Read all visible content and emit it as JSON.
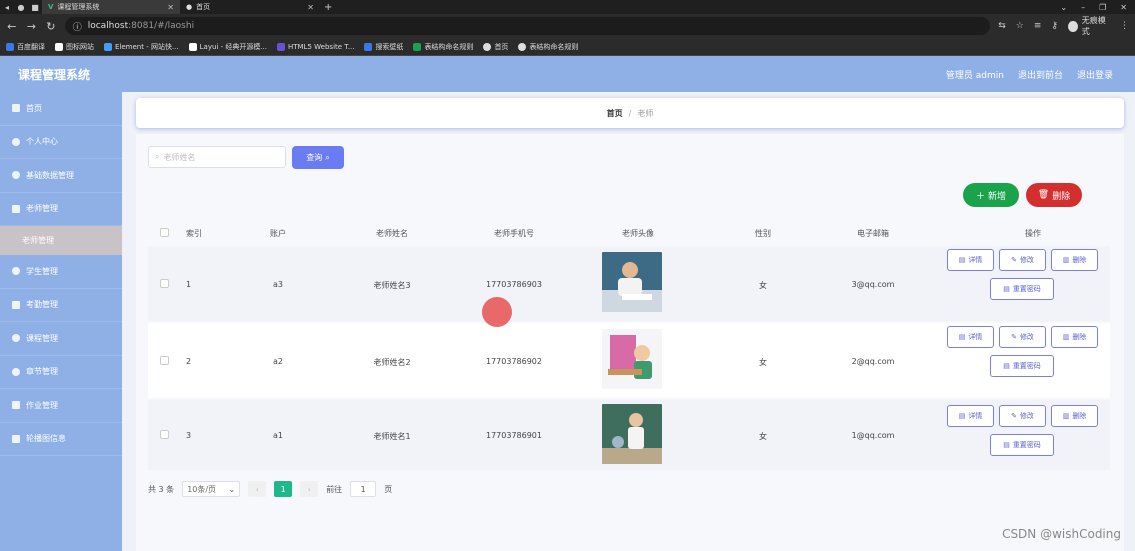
{
  "browser": {
    "tabs": [
      {
        "title": "课程管理系统",
        "active": true
      },
      {
        "title": "首页",
        "active": false
      }
    ],
    "url_host": "localhost",
    "url_rest": ":8081/#/laoshi",
    "incognito_label": "无痕模式",
    "bookmarks": [
      {
        "label": "百度翻译",
        "color": "#3b78e7"
      },
      {
        "label": "图标网站",
        "color": "#ffffff"
      },
      {
        "label": "Element - 网站快...",
        "color": "#409eff"
      },
      {
        "label": "Layui - 经典开源模...",
        "color": "#ffffff"
      },
      {
        "label": "HTML5 Website T...",
        "color": "#6a4fd8"
      },
      {
        "label": "搜索壁纸",
        "color": "#3b78e7"
      },
      {
        "label": "表结构命名规则",
        "color": "#1aa34a"
      },
      {
        "label": "首页",
        "color": "#dddddd"
      },
      {
        "label": "表结构命名规则",
        "color": "#dddddd"
      }
    ]
  },
  "header": {
    "title": "课程管理系统",
    "admin_label": "管理员 admin",
    "exit_to_front": "退出到前台",
    "logout": "退出登录"
  },
  "sidebar": {
    "items": [
      {
        "label": "首页",
        "icon": "home-icon"
      },
      {
        "label": "个人中心",
        "icon": "user-icon"
      },
      {
        "label": "基础数据管理",
        "icon": "settings-icon"
      },
      {
        "label": "老师管理",
        "icon": "folder-icon"
      },
      {
        "label": "学生管理",
        "icon": "student-icon"
      },
      {
        "label": "考勤管理",
        "icon": "calendar-icon"
      },
      {
        "label": "课程管理",
        "icon": "book-icon"
      },
      {
        "label": "章节管理",
        "icon": "chapter-icon"
      },
      {
        "label": "作业管理",
        "icon": "chart-icon"
      },
      {
        "label": "轮播图信息",
        "icon": "image-icon"
      }
    ],
    "active_sub": "老师管理"
  },
  "breadcrumb": {
    "home": "首页",
    "separator": "/",
    "current": "老师"
  },
  "search": {
    "placeholder": "老师姓名",
    "button": "查询"
  },
  "actions": {
    "add": "新增",
    "delete": "删除"
  },
  "table": {
    "columns": [
      "索引",
      "账户",
      "老师姓名",
      "老师手机号",
      "老师头像",
      "性别",
      "电子邮箱",
      "操作"
    ],
    "rows": [
      {
        "index": "1",
        "account": "a3",
        "name": "老师姓名3",
        "phone": "17703786903",
        "gender": "女",
        "email": "3@qq.com"
      },
      {
        "index": "2",
        "account": "a2",
        "name": "老师姓名2",
        "phone": "17703786902",
        "gender": "女",
        "email": "2@qq.com"
      },
      {
        "index": "3",
        "account": "a1",
        "name": "老师姓名1",
        "phone": "17703786901",
        "gender": "女",
        "email": "1@qq.com"
      }
    ],
    "row_ops": {
      "detail": "详情",
      "edit": "修改",
      "remove": "删除",
      "reset": "重置密码"
    }
  },
  "pagination": {
    "total": "共 3 条",
    "page_size": "10条/页",
    "current_page": "1",
    "goto_label": "前往",
    "goto_value": "1",
    "page_unit": "页"
  },
  "watermark": "CSDN @wishCoding",
  "colors": {
    "sidebar": "#8fb0e6",
    "primary": "#6b7cf2",
    "success": "#1aa34a",
    "danger": "#d32f2f",
    "page_active": "#1fb88a"
  }
}
